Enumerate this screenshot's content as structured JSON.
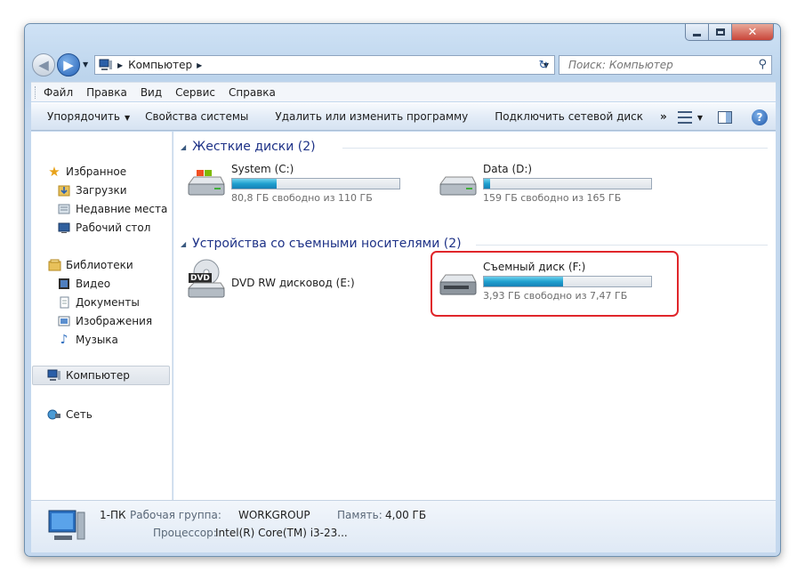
{
  "window": {
    "caption": {
      "minimize": "_",
      "maximize": "□",
      "close": "✕"
    }
  },
  "address": {
    "crumb": "Компьютер",
    "search_placeholder": "Поиск: Компьютер"
  },
  "menu": [
    "Файл",
    "Правка",
    "Вид",
    "Сервис",
    "Справка"
  ],
  "command_bar": {
    "organize": "Упорядочить",
    "system_properties": "Свойства системы",
    "uninstall": "Удалить или изменить программу",
    "map_drive": "Подключить сетевой диск",
    "more": "»"
  },
  "nav": {
    "favorites": "Избранное",
    "downloads": "Загрузки",
    "recent": "Недавние места",
    "desktop": "Рабочий стол",
    "libraries": "Библиотеки",
    "video": "Видео",
    "documents": "Документы",
    "images": "Изображения",
    "music": "Музыка",
    "computer": "Компьютер",
    "network": "Сеть"
  },
  "groups": {
    "hard_disks": "Жесткие диски (2)",
    "removable": "Устройства со съемными носителями (2)"
  },
  "drives": [
    {
      "name": "System (C:)",
      "free_text": "80,8 ГБ свободно из 110 ГБ",
      "used_fraction": 0.265
    },
    {
      "name": "Data (D:)",
      "free_text": "159 ГБ свободно из 165 ГБ",
      "used_fraction": 0.036
    },
    {
      "name": "DVD RW дисковод (E:)",
      "dvd_label": "DVD"
    },
    {
      "name": "Съемный диск (F:)",
      "free_text": "3,93 ГБ свободно из 7,47 ГБ",
      "used_fraction": 0.474
    }
  ],
  "status": {
    "pc_name": "1-ПК",
    "workgroup_label": "Рабочая группа:",
    "workgroup_value": "WORKGROUP",
    "memory_label": "Память:",
    "memory_value": "4,00 ГБ",
    "cpu_label": "Процессор:",
    "cpu_value": "Intel(R) Core(TM) i3-23..."
  },
  "colors": {
    "highlight_border": "#e0262b",
    "group_title": "#1e3287",
    "progress_fill": "#1fa0cf"
  }
}
